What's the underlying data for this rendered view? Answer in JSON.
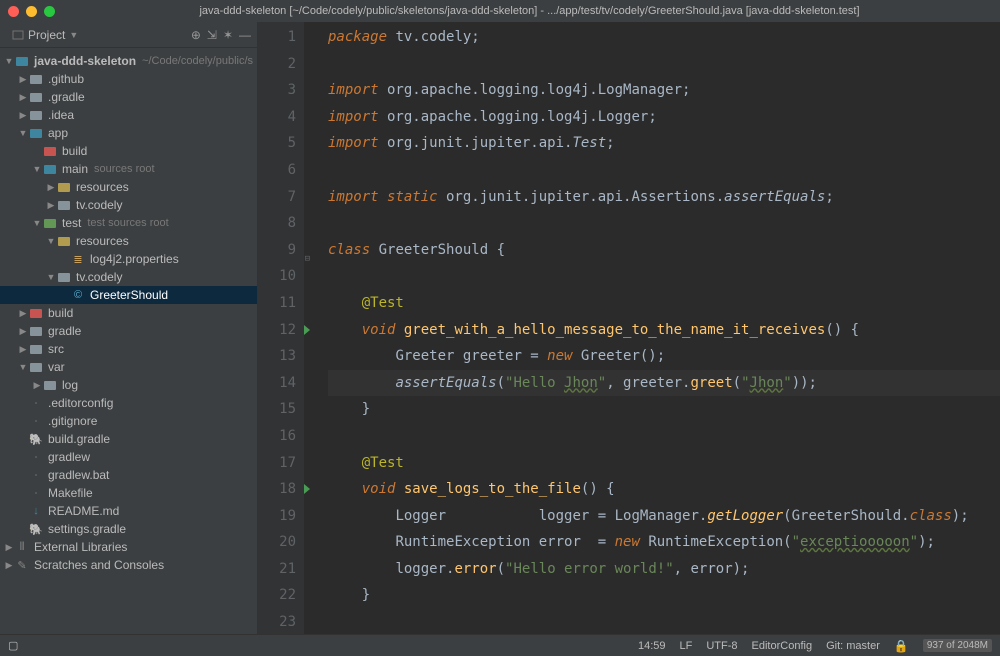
{
  "window": {
    "title": "java-ddd-skeleton [~/Code/codely/public/skeletons/java-ddd-skeleton] - .../app/test/tv/codely/GreeterShould.java [java-ddd-skeleton.test]"
  },
  "sidebar": {
    "title": "Project",
    "root": {
      "name": "java-ddd-skeleton",
      "path": "~/Code/codely/public/s"
    },
    "items": [
      {
        "indent": 1,
        "tw": "closed",
        "icon": "folder-gray",
        "label": ".github"
      },
      {
        "indent": 1,
        "tw": "closed",
        "icon": "folder-gray",
        "label": ".gradle"
      },
      {
        "indent": 1,
        "tw": "closed",
        "icon": "folder-gray",
        "label": ".idea"
      },
      {
        "indent": 1,
        "tw": "open",
        "icon": "folder-blue",
        "label": "app"
      },
      {
        "indent": 2,
        "tw": "none",
        "icon": "folder-red",
        "label": "build"
      },
      {
        "indent": 2,
        "tw": "open",
        "icon": "folder-blue",
        "label": "main",
        "hint": "sources root"
      },
      {
        "indent": 3,
        "tw": "closed",
        "icon": "folder-yellow",
        "label": "resources"
      },
      {
        "indent": 3,
        "tw": "closed",
        "icon": "folder-gray",
        "label": "tv.codely"
      },
      {
        "indent": 2,
        "tw": "open",
        "icon": "folder-green",
        "label": "test",
        "hint": "test sources root"
      },
      {
        "indent": 3,
        "tw": "open",
        "icon": "folder-yellow",
        "label": "resources"
      },
      {
        "indent": 4,
        "tw": "none",
        "icon": "file-prop",
        "label": "log4j2.properties"
      },
      {
        "indent": 3,
        "tw": "open",
        "icon": "folder-gray",
        "label": "tv.codely"
      },
      {
        "indent": 4,
        "tw": "none",
        "icon": "file-class",
        "label": "GreeterShould",
        "selected": true
      },
      {
        "indent": 1,
        "tw": "closed",
        "icon": "folder-red",
        "label": "build"
      },
      {
        "indent": 1,
        "tw": "closed",
        "icon": "folder-gray",
        "label": "gradle"
      },
      {
        "indent": 1,
        "tw": "closed",
        "icon": "folder-gray",
        "label": "src"
      },
      {
        "indent": 1,
        "tw": "open",
        "icon": "folder-gray",
        "label": "var"
      },
      {
        "indent": 2,
        "tw": "closed",
        "icon": "folder-gray",
        "label": "log"
      },
      {
        "indent": 1,
        "tw": "none",
        "icon": "file",
        "label": ".editorconfig"
      },
      {
        "indent": 1,
        "tw": "none",
        "icon": "file",
        "label": ".gitignore"
      },
      {
        "indent": 1,
        "tw": "none",
        "icon": "file-gradle",
        "label": "build.gradle"
      },
      {
        "indent": 1,
        "tw": "none",
        "icon": "file",
        "label": "gradlew"
      },
      {
        "indent": 1,
        "tw": "none",
        "icon": "file",
        "label": "gradlew.bat"
      },
      {
        "indent": 1,
        "tw": "none",
        "icon": "file",
        "label": "Makefile"
      },
      {
        "indent": 1,
        "tw": "none",
        "icon": "file-md",
        "label": "README.md"
      },
      {
        "indent": 1,
        "tw": "none",
        "icon": "file-gradle",
        "label": "settings.gradle"
      },
      {
        "indent": 0,
        "tw": "closed",
        "icon": "lib",
        "label": "External Libraries"
      },
      {
        "indent": 0,
        "tw": "closed",
        "icon": "scratch",
        "label": "Scratches and Consoles"
      }
    ]
  },
  "editor": {
    "highlighted_line": 14,
    "run_markers": [
      12,
      18
    ],
    "fold_marker": 9,
    "tokens": [
      [
        {
          "t": "package",
          "c": "kw"
        },
        {
          "t": " tv.codely;",
          "c": "pkg"
        }
      ],
      [],
      [
        {
          "t": "import",
          "c": "kw"
        },
        {
          "t": " org.apache.logging.log4j.",
          "c": "pkg"
        },
        {
          "t": "LogManager",
          "c": "type"
        },
        {
          "t": ";",
          "c": "op"
        }
      ],
      [
        {
          "t": "import",
          "c": "kw"
        },
        {
          "t": " org.apache.logging.log4j.",
          "c": "pkg"
        },
        {
          "t": "Logger",
          "c": "type"
        },
        {
          "t": ";",
          "c": "op"
        }
      ],
      [
        {
          "t": "import",
          "c": "kw"
        },
        {
          "t": " org.junit.jupiter.api.",
          "c": "pkg"
        },
        {
          "t": "Test",
          "c": "type staticm"
        },
        {
          "t": ";",
          "c": "op"
        }
      ],
      [],
      [
        {
          "t": "import static",
          "c": "kw"
        },
        {
          "t": " org.junit.jupiter.api.Assertions.",
          "c": "pkg"
        },
        {
          "t": "assertEquals",
          "c": "type staticm"
        },
        {
          "t": ";",
          "c": "op"
        }
      ],
      [],
      [
        {
          "t": "class",
          "c": "kw"
        },
        {
          "t": " GreeterShould {",
          "c": "type"
        }
      ],
      [],
      [
        {
          "t": "    ",
          "c": "lowlight"
        },
        {
          "t": "@Test",
          "c": "ann"
        }
      ],
      [
        {
          "t": "    ",
          "c": "lowlight"
        },
        {
          "t": "void",
          "c": "kw"
        },
        {
          "t": " ",
          "c": ""
        },
        {
          "t": "greet_with_a_hello_message_to_the_name_it_receives",
          "c": "decl"
        },
        {
          "t": "() {",
          "c": "op"
        }
      ],
      [
        {
          "t": "        ",
          "c": "lowlight"
        },
        {
          "t": "Greeter greeter = ",
          "c": "type"
        },
        {
          "t": "new",
          "c": "kw"
        },
        {
          "t": " Greeter();",
          "c": "type"
        }
      ],
      [
        {
          "t": "        ",
          "c": "lowlight"
        },
        {
          "t": "assertEquals",
          "c": "type staticm"
        },
        {
          "t": "(",
          "c": "op"
        },
        {
          "t": "\"Hello ",
          "c": "str"
        },
        {
          "t": "Jhon",
          "c": "str underline"
        },
        {
          "t": "\"",
          "c": "str"
        },
        {
          "t": ", greeter.",
          "c": "type"
        },
        {
          "t": "greet",
          "c": "mname"
        },
        {
          "t": "(",
          "c": "op"
        },
        {
          "t": "\"",
          "c": "str"
        },
        {
          "t": "Jhon",
          "c": "str underline"
        },
        {
          "t": "\"",
          "c": "str"
        },
        {
          "t": "));",
          "c": "op"
        }
      ],
      [
        {
          "t": "    }",
          "c": "op"
        }
      ],
      [],
      [
        {
          "t": "    ",
          "c": "lowlight"
        },
        {
          "t": "@Test",
          "c": "ann"
        }
      ],
      [
        {
          "t": "    ",
          "c": "lowlight"
        },
        {
          "t": "void",
          "c": "kw"
        },
        {
          "t": " ",
          "c": ""
        },
        {
          "t": "save_logs_to_the_file",
          "c": "decl"
        },
        {
          "t": "() {",
          "c": "op"
        }
      ],
      [
        {
          "t": "        ",
          "c": "lowlight"
        },
        {
          "t": "Logger           logger = LogManager.",
          "c": "type"
        },
        {
          "t": "getLogger",
          "c": "mname staticm"
        },
        {
          "t": "(GreeterShould.",
          "c": "type"
        },
        {
          "t": "class",
          "c": "kw"
        },
        {
          "t": ");",
          "c": "op"
        }
      ],
      [
        {
          "t": "        ",
          "c": "lowlight"
        },
        {
          "t": "RuntimeException error  = ",
          "c": "type"
        },
        {
          "t": "new",
          "c": "kw"
        },
        {
          "t": " RuntimeException(",
          "c": "type"
        },
        {
          "t": "\"",
          "c": "str"
        },
        {
          "t": "exceptiooooon",
          "c": "str underline"
        },
        {
          "t": "\"",
          "c": "str"
        },
        {
          "t": ");",
          "c": "op"
        }
      ],
      [
        {
          "t": "        ",
          "c": "lowlight"
        },
        {
          "t": "logger.",
          "c": "type"
        },
        {
          "t": "error",
          "c": "mname"
        },
        {
          "t": "(",
          "c": "op"
        },
        {
          "t": "\"Hello error world!\"",
          "c": "str"
        },
        {
          "t": ", error);",
          "c": "op"
        }
      ],
      [
        {
          "t": "    }",
          "c": "op"
        }
      ],
      []
    ]
  },
  "status": {
    "caret": "14:59",
    "line_sep": "LF",
    "encoding": "UTF-8",
    "style": "EditorConfig",
    "git": "Git: master",
    "memory": "937 of 2048M"
  }
}
